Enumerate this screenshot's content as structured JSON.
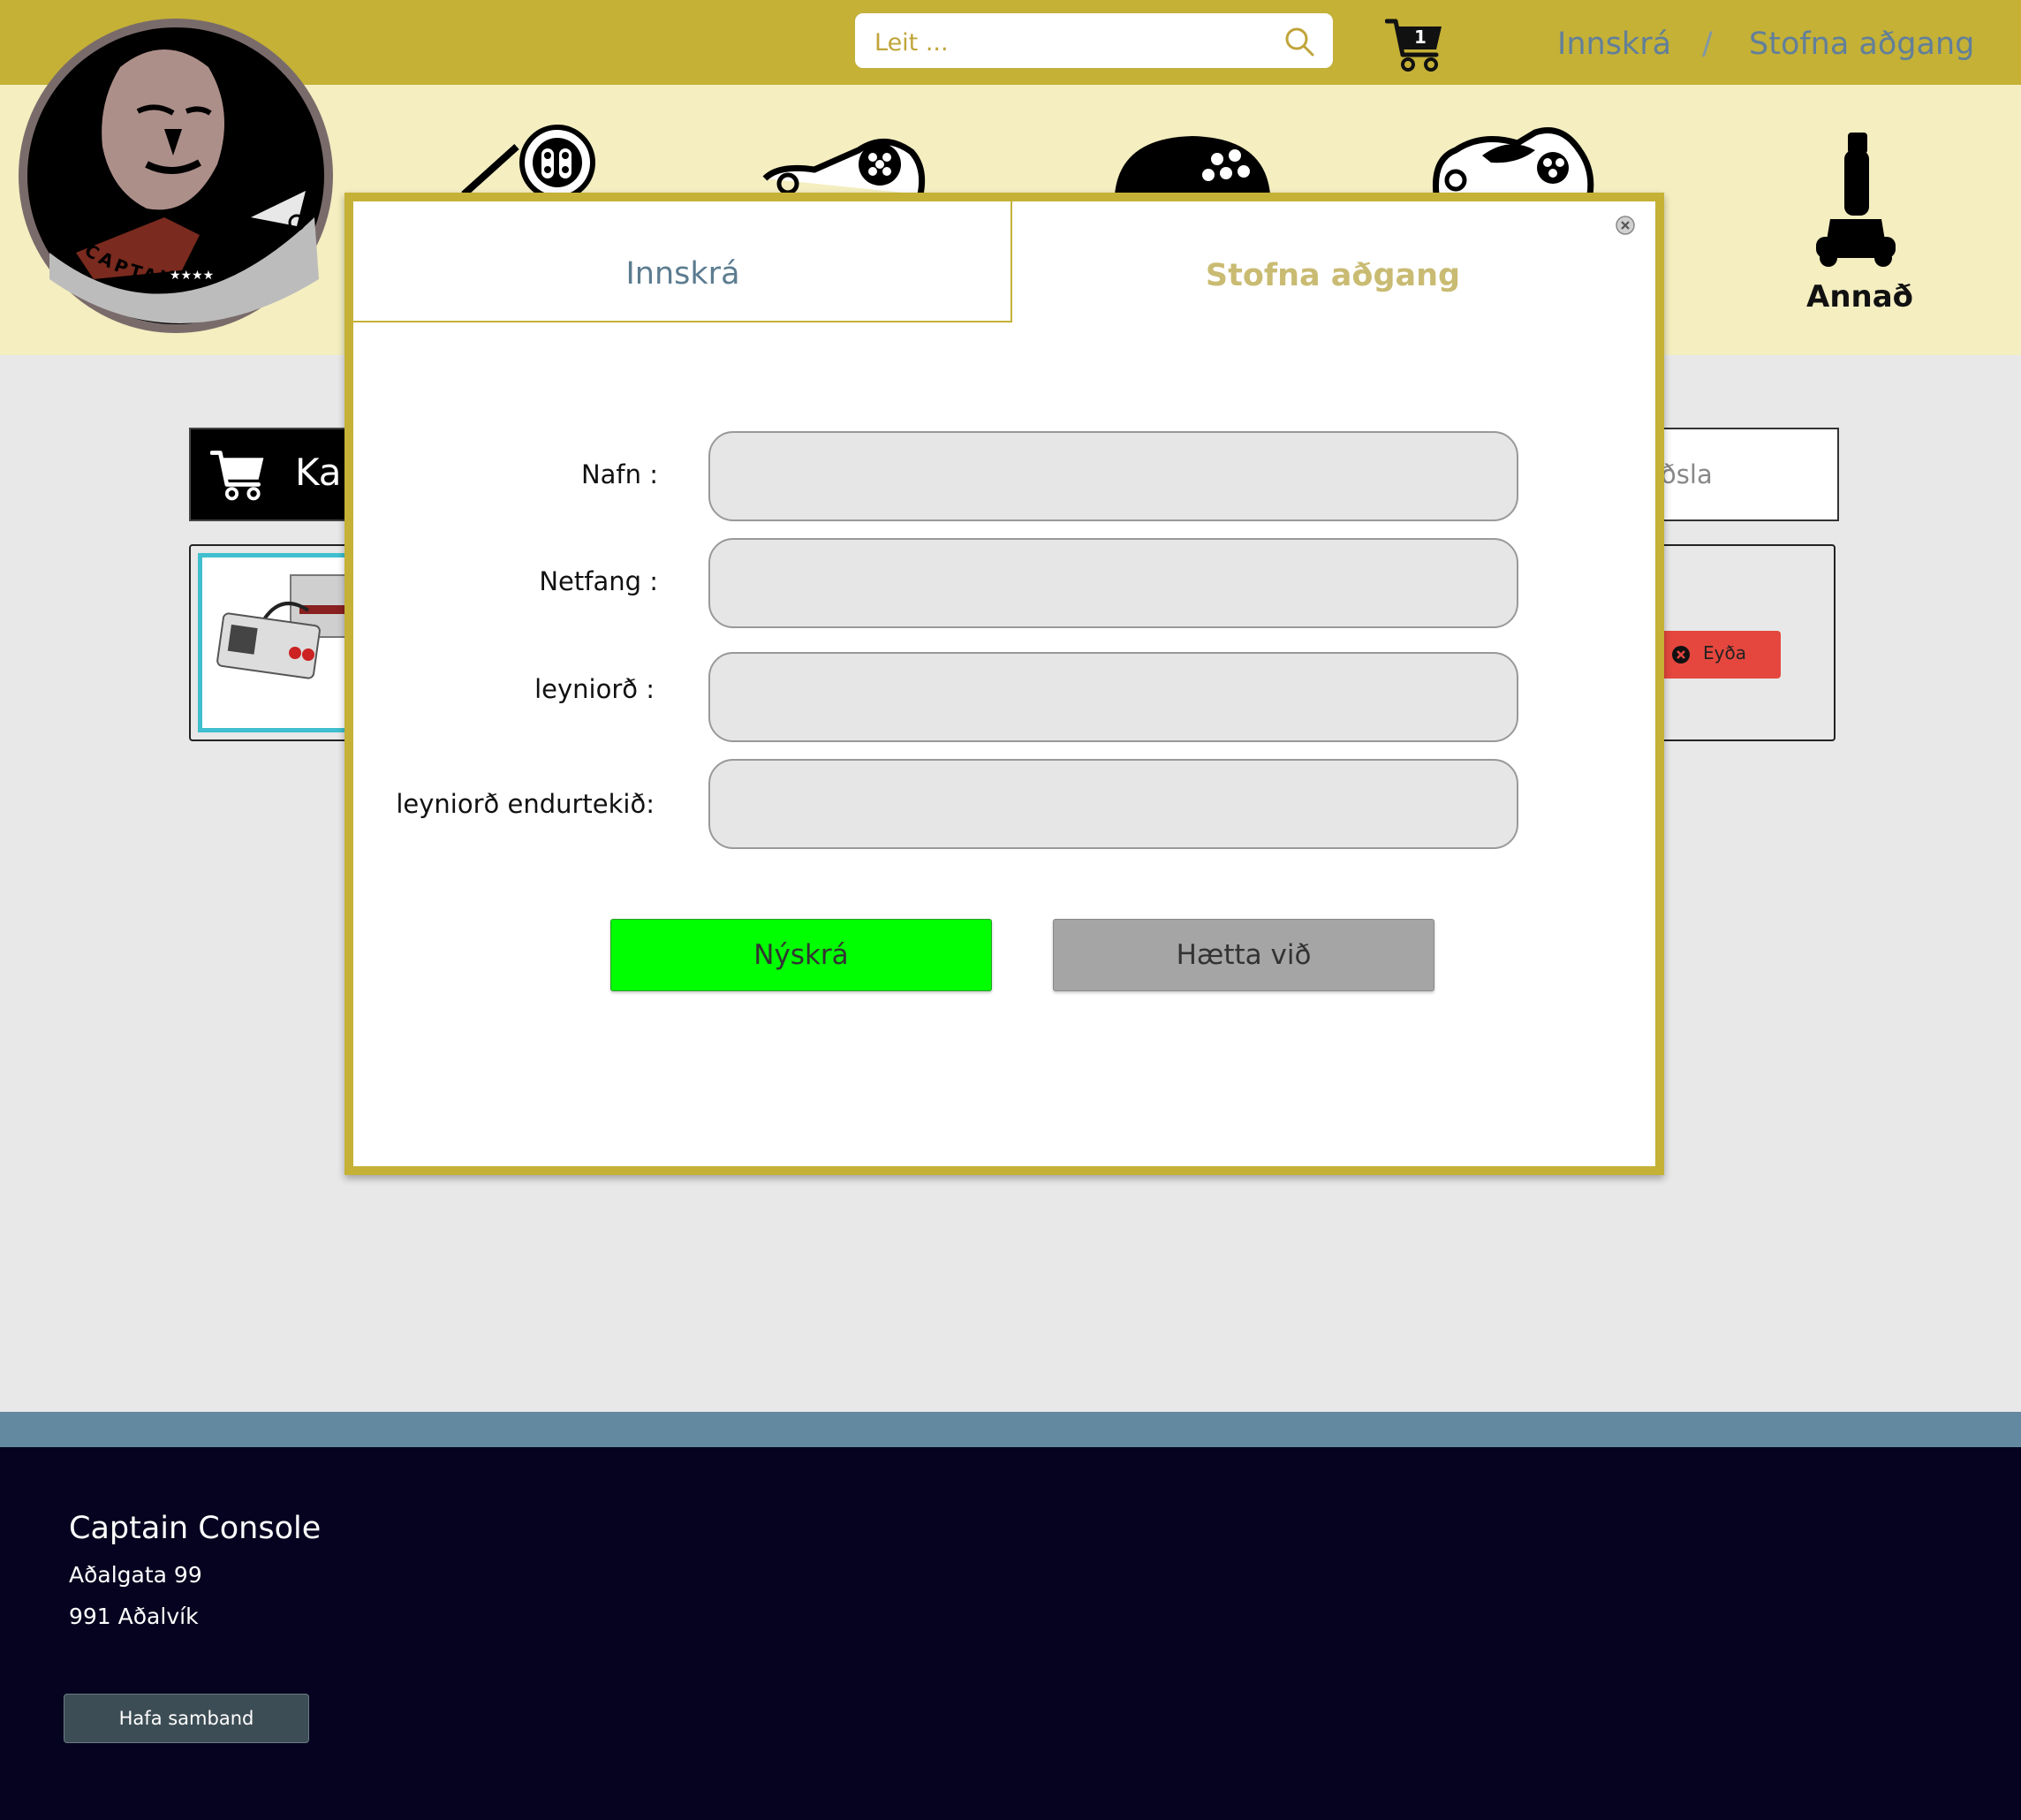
{
  "header": {
    "search_placeholder": "Leit ...",
    "cart_count": "1",
    "login_link": "Innskrá",
    "separator": "/",
    "signup_link": "Stofna aðgang"
  },
  "categories": {
    "items": [
      {
        "icon": "snes-controller-icon"
      },
      {
        "icon": "nes-gamepad-icon"
      },
      {
        "icon": "sega-controller-icon"
      },
      {
        "icon": "gamepad-icon"
      },
      {
        "icon": "joystick-icon",
        "label": "Annað"
      }
    ]
  },
  "logo": {
    "text": "CAPTAIN CONSOLE"
  },
  "cart_page": {
    "header_label": "Kar",
    "delivery_label": "iðsla",
    "delete_label": "Eyða"
  },
  "modal": {
    "tab_login": "Innskrá",
    "tab_signup": "Stofna aðgang",
    "fields": {
      "name_label": "Nafn :",
      "email_label": "Netfang :",
      "password_label": "leyniorð :",
      "password_repeat_label": "leyniorð endurtekið:"
    },
    "register_button": "Nýskrá",
    "cancel_button": "Hætta við"
  },
  "footer": {
    "company": "Captain Console",
    "address_line1": "Aðalgata 99",
    "address_line2": "991 Aðalvík",
    "contact_button": "Hafa samband"
  },
  "colors": {
    "topbar": "#c4b136",
    "category_bar": "#f4eec0",
    "nav_link": "#627f9a",
    "register": "#00ff00",
    "cancel": "#a5a5a5",
    "delete": "#e5473e",
    "footer": "#05031f",
    "footer_strip": "#6389a0"
  }
}
